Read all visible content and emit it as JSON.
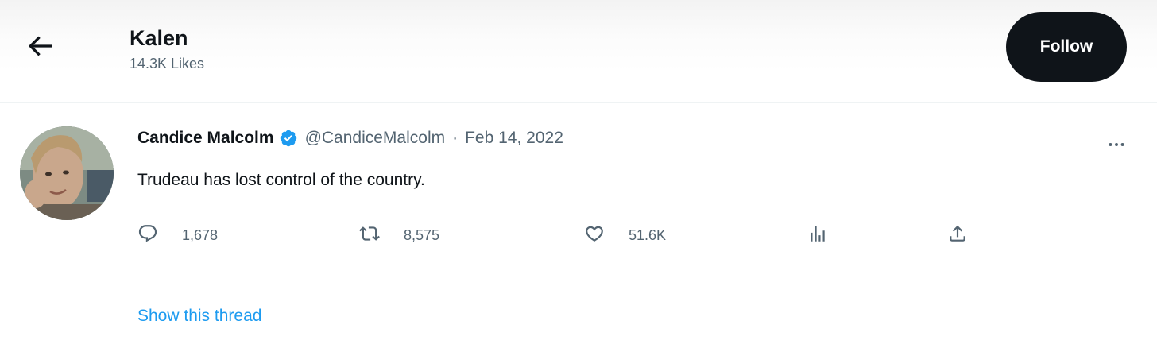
{
  "header": {
    "title": "Kalen",
    "subtitle": "14.3K Likes",
    "follow_label": "Follow",
    "back_icon": "arrow-left-icon"
  },
  "tweet": {
    "author_name": "Candice Malcolm",
    "verified_icon": "verified-badge-icon",
    "handle": "@CandiceMalcolm",
    "separator": "·",
    "date": "Feb 14, 2022",
    "text": "Trudeau has lost control of the country.",
    "more_icon": "more-options-icon",
    "actions": {
      "reply_count": "1,678",
      "retweet_count": "8,575",
      "like_count": "51.6K"
    },
    "show_thread_label": "Show this thread"
  },
  "colors": {
    "accent": "#1d9bf0",
    "text_primary": "#0f1419",
    "text_secondary": "#536471",
    "follow_bg": "#0f1419"
  }
}
